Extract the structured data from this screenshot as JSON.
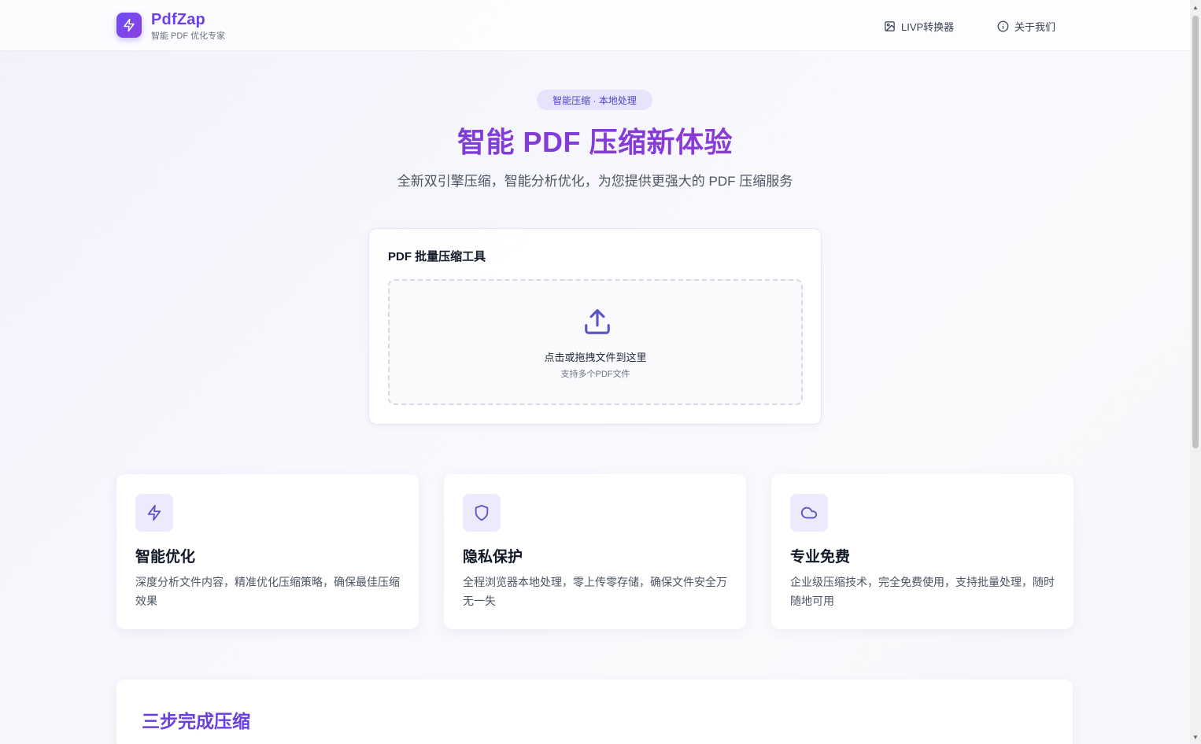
{
  "header": {
    "brand_name": "PdfZap",
    "brand_sub": "智能 PDF 优化专家",
    "nav": [
      {
        "label": "LIVP转换器",
        "icon": "image-icon"
      },
      {
        "label": "关于我们",
        "icon": "info-icon"
      }
    ]
  },
  "hero": {
    "badge": "智能压缩 · 本地处理",
    "title": "智能 PDF 压缩新体验",
    "description": "全新双引擎压缩，智能分析优化，为您提供更强大的 PDF 压缩服务"
  },
  "upload": {
    "title": "PDF 批量压缩工具",
    "drop_main": "点击或拖拽文件到这里",
    "drop_sub": "支持多个PDF文件"
  },
  "features": [
    {
      "icon": "lightning-icon",
      "title": "智能优化",
      "desc": "深度分析文件内容，精准优化压缩策略，确保最佳压缩效果"
    },
    {
      "icon": "shield-icon",
      "title": "隐私保护",
      "desc": "全程浏览器本地处理，零上传零存储，确保文件安全万无一失"
    },
    {
      "icon": "cloud-icon",
      "title": "专业免费",
      "desc": "企业级压缩技术，完全免费使用，支持批量处理，随时随地可用"
    }
  ],
  "steps": {
    "title": "三步完成压缩"
  },
  "colors": {
    "accent": "#6d3fe6",
    "accent_secondary": "#9a38cf",
    "badge_bg": "#e6e3fa",
    "icon_stroke": "#5b55c9"
  }
}
